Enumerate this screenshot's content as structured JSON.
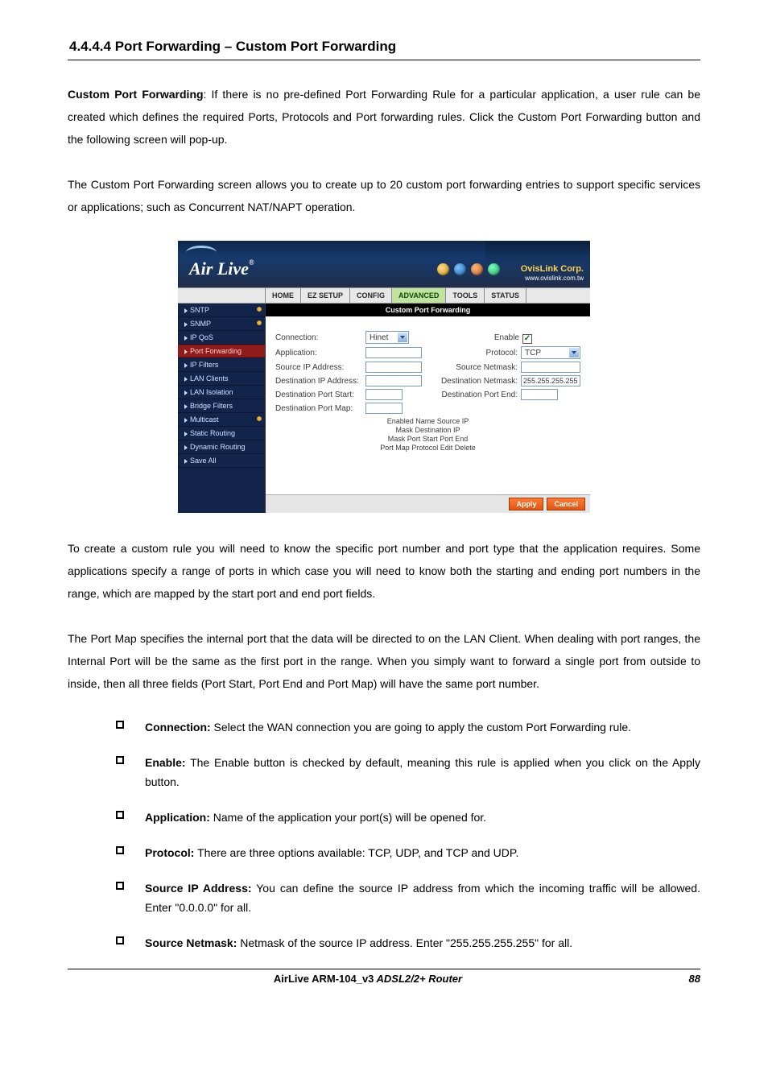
{
  "section": {
    "heading": "4.4.4.4 Port Forwarding – Custom Port Forwarding"
  },
  "para1": {
    "lead": "Custom Port Forwarding",
    "rest": ": If there is no pre-defined Port Forwarding Rule for a particular application, a user rule can be created which defines the required Ports, Protocols and Port forwarding rules. Click the Custom Port Forwarding button and the following screen will pop-up."
  },
  "para2": "The Custom Port Forwarding screen allows you to create up to 20 custom port forwarding entries to support specific services or applications; such as Concurrent NAT/NAPT operation.",
  "para3": "To create a custom rule you will need to know the specific port number and port type that the application requires. Some applications specify a range of ports in which case you will need to know both the starting and ending port numbers in the range, which are mapped by the start port and end port fields.",
  "para4": "The Port Map specifies the internal port that the data will be directed to on the LAN Client. When dealing with port ranges, the Internal Port will be the same as the first port in the range. When you simply want to forward a single port from outside to inside, then all three fields (Port Start, Port End and Port Map) will have the same port number.",
  "bullets": [
    {
      "label": "Connection:",
      "text": " Select the WAN connection you are going to apply the custom Port Forwarding rule."
    },
    {
      "label": "Enable:",
      "text": " The Enable button is checked by default, meaning this rule is applied when you click on the Apply button."
    },
    {
      "label": "Application:",
      "text": " Name of the application your port(s) will be opened for."
    },
    {
      "label": "Protocol:",
      "text": " There are three options available: TCP, UDP, and TCP and UDP."
    },
    {
      "label": "Source IP Address:",
      "text": " You can define the source IP address from which the incoming traffic will be allowed. Enter \"0.0.0.0\" for all."
    },
    {
      "label": "Source Netmask:",
      "text": " Netmask of the source IP address. Enter \"255.255.255.255\" for all."
    }
  ],
  "footer": {
    "product_a": "AirLive ARM-104_v3",
    "product_b": " ADSL2/2+ Router",
    "page": "88"
  },
  "shot": {
    "brand": "Air Live",
    "corp": "OvisLink Corp.",
    "url": "www.ovislink.com.tw",
    "tabs": [
      "HOME",
      "EZ SETUP",
      "CONFIG",
      "ADVANCED",
      "TOOLS",
      "STATUS"
    ],
    "active_tab": 3,
    "sidebar": [
      "SNTP",
      "SNMP",
      "IP QoS",
      "Port Forwarding",
      "IP Filters",
      "LAN Clients",
      "LAN Isolation",
      "Bridge Filters",
      "Multicast",
      "Static Routing",
      "Dynamic Routing",
      "Save All"
    ],
    "active_side": 3,
    "main_title": "Custom Port Forwarding",
    "labels": {
      "connection": "Connection:",
      "enable": "Enable",
      "application": "Application:",
      "protocol": "Protocol:",
      "src_ip": "Source IP Address:",
      "src_mask": "Source Netmask:",
      "dst_ip": "Destination IP Address:",
      "dst_mask": "Destination Netmask:",
      "dst_start": "Destination Port Start:",
      "dst_end": "Destination Port End:",
      "dst_map": "Destination Port Map:"
    },
    "values": {
      "connection": "Hinet",
      "protocol": "TCP",
      "dst_mask": "255.255.255.255"
    },
    "table_head": "Enabled Name Source IP Mask Destination IP Mask Port Start Port End Port Map Protocol Edit Delete",
    "buttons": {
      "apply": "Apply",
      "cancel": "Cancel"
    }
  }
}
